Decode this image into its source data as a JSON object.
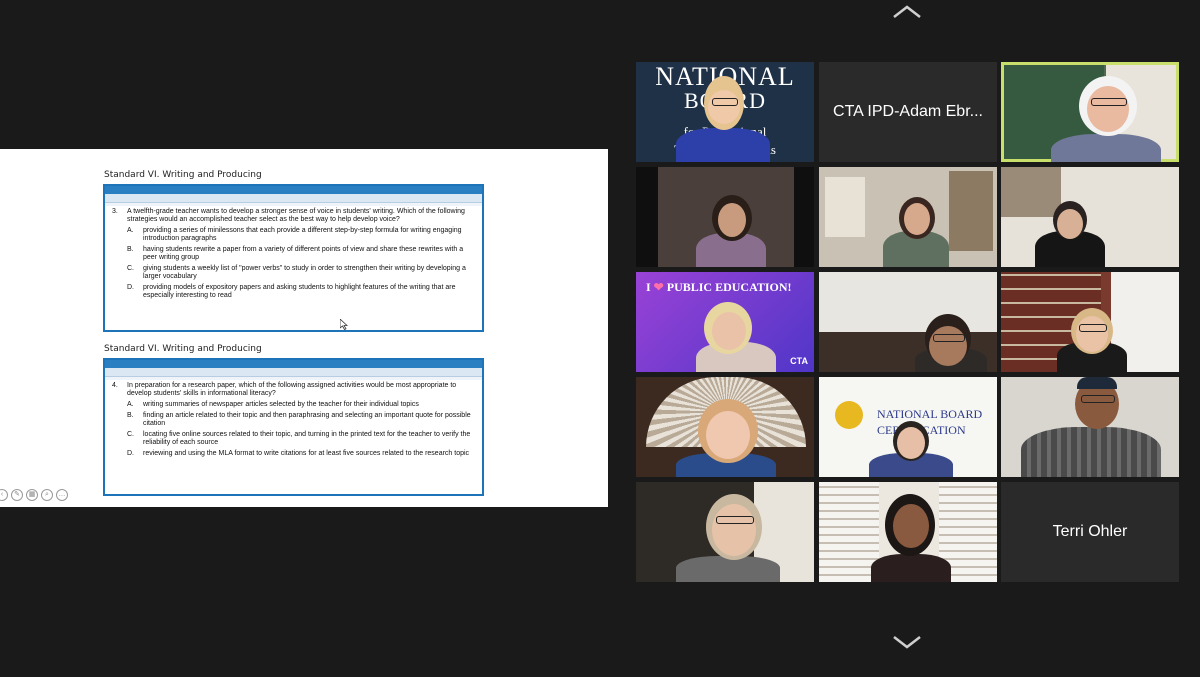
{
  "slide": {
    "questions": [
      {
        "heading": "Standard VI. Writing and Producing",
        "number": "3.",
        "stem": "A twelfth-grade teacher wants to develop a stronger sense of voice in students' writing. Which of the following strategies would an accomplished teacher select as the best way to help develop voice?",
        "options": [
          {
            "letter": "A.",
            "text": "providing a series of minilessons that each provide a different step-by-step formula for writing engaging introduction paragraphs"
          },
          {
            "letter": "B.",
            "text": "having students rewrite a paper from a variety of different points of view and share these rewrites with a peer writing group"
          },
          {
            "letter": "C.",
            "text": "giving students a weekly list of \"power verbs\" to study in order to strengthen their writing by developing a larger vocabulary"
          },
          {
            "letter": "D.",
            "text": "providing models of expository papers and asking students to highlight features of the writing that are especially interesting to read"
          }
        ]
      },
      {
        "heading": "Standard VI. Writing and Producing",
        "number": "4.",
        "stem": "In preparation for a research paper, which of the following assigned activities would be most appropriate to develop students' skills in informational literacy?",
        "options": [
          {
            "letter": "A.",
            "text": "writing summaries of newspaper articles selected by the teacher for their individual topics"
          },
          {
            "letter": "B.",
            "text": "finding an article related to their topic and then paraphrasing and selecting an important quote for possible citation"
          },
          {
            "letter": "C.",
            "text": "locating five online sources related to their topic, and turning in the printed text for the teacher to verify the reliability of each source"
          },
          {
            "letter": "D.",
            "text": "reviewing and using the MLA format to write citations for at least five sources related to the research topic"
          }
        ]
      }
    ]
  },
  "gallery": {
    "nb_logo": {
      "line1": "NATIONAL",
      "line2": "BOARD",
      "line3": "for Professional",
      "line4": "Teaching Standards"
    },
    "name_tiles": {
      "adam": "CTA IPD-Adam Ebr...",
      "terri": "Terri Ohler"
    },
    "public_ed": {
      "prefix": "I",
      "suffix": "PUBLIC EDUCATION!",
      "badge": "CTA"
    },
    "nb_cert": {
      "line1": "NATIONAL BOARD",
      "line2": "CERTIFICATION"
    }
  },
  "colors": {
    "active_speaker": "#c8e06b",
    "slide_box_border": "#1e74b8",
    "background": "#1a1a1a"
  },
  "icons": [
    "chevron-up-icon",
    "chevron-down-icon",
    "heart-icon",
    "mouse-cursor-icon"
  ]
}
